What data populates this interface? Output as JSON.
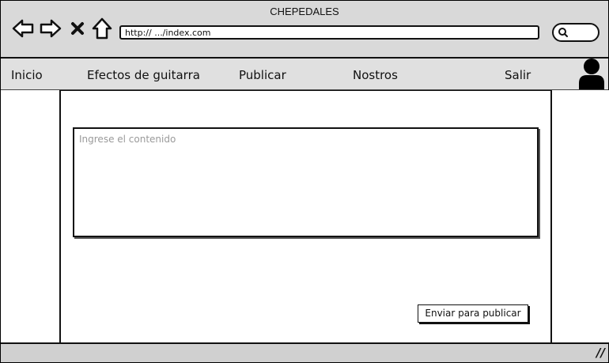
{
  "window": {
    "title": "CHEPEDALES",
    "url": "http:// .../index.com"
  },
  "icons": {
    "back": "back-arrow-icon",
    "forward": "forward-arrow-icon",
    "stop": "close-icon",
    "home": "home-icon",
    "search": "search-icon",
    "user": "user-avatar-icon",
    "resize": "resize-grip-icon"
  },
  "menu": {
    "items": [
      {
        "label": "Inicio"
      },
      {
        "label": "Efectos de guitarra"
      },
      {
        "label": "Publicar"
      },
      {
        "label": "Nostros"
      },
      {
        "label": "Salir"
      }
    ]
  },
  "editor": {
    "placeholder": "Ingrese el contenido",
    "value": ""
  },
  "actions": {
    "submit_label": "Enviar para publicar"
  },
  "colors": {
    "chrome": "#d9d9d9",
    "menubar": "#e0e0e0",
    "placeholder": "#9a9a9a"
  }
}
